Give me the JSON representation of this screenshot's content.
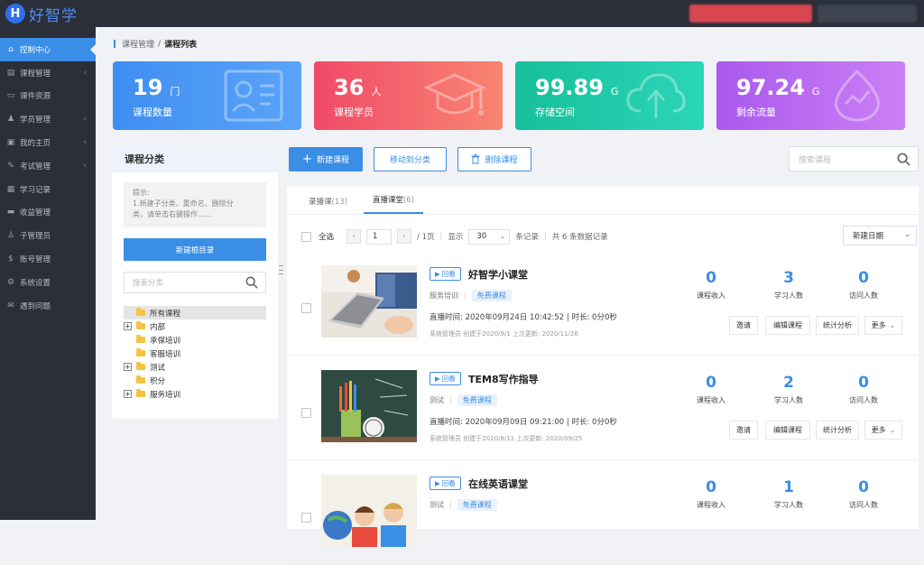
{
  "app": {
    "logo_letter": "H",
    "logo_text": "好智学"
  },
  "sidebar": {
    "items": [
      {
        "label": "控制中心",
        "icon": "home-icon",
        "glyph": "⌂",
        "arrow": false,
        "active": true
      },
      {
        "label": "课程管理",
        "icon": "book-icon",
        "glyph": "▤",
        "arrow": true,
        "active": false
      },
      {
        "label": "课件资源",
        "icon": "file-icon",
        "glyph": "▭",
        "arrow": false,
        "active": false
      },
      {
        "label": "学员管理",
        "icon": "user-icon",
        "glyph": "♟",
        "arrow": true,
        "active": false
      },
      {
        "label": "我的主页",
        "icon": "page-icon",
        "glyph": "▣",
        "arrow": true,
        "active": false
      },
      {
        "label": "考试管理",
        "icon": "exam-icon",
        "glyph": "✎",
        "arrow": true,
        "active": false
      },
      {
        "label": "学习记录",
        "icon": "record-icon",
        "glyph": "▦",
        "arrow": false,
        "active": false
      },
      {
        "label": "收益管理",
        "icon": "wallet-icon",
        "glyph": "▬",
        "arrow": false,
        "active": false
      },
      {
        "label": "子管理员",
        "icon": "admin-icon",
        "glyph": "♙",
        "arrow": false,
        "active": false
      },
      {
        "label": "账号管理",
        "icon": "dollar-icon",
        "glyph": "$",
        "arrow": false,
        "active": false
      },
      {
        "label": "系统设置",
        "icon": "gear-icon",
        "glyph": "⚙",
        "arrow": false,
        "active": false
      },
      {
        "label": "遇到问题",
        "icon": "help-icon",
        "glyph": "✉",
        "arrow": false,
        "active": false
      }
    ]
  },
  "breadcrumb": {
    "parent": "课程管理",
    "separator": "/",
    "current": "课程列表"
  },
  "stats_cards": [
    {
      "value": "19",
      "unit": "门",
      "label": "课程数量",
      "color": "#3d8cf0"
    },
    {
      "value": "36",
      "unit": "人",
      "label": "课程学员",
      "color": "#f0506e"
    },
    {
      "value": "99.89",
      "unit": "G",
      "label": "存储空间",
      "color": "#1fc3a3"
    },
    {
      "value": "97.24",
      "unit": "G",
      "label": "剩余流量",
      "color": "#b067f0"
    }
  ],
  "category_panel": {
    "title": "课程分类",
    "tip_lines": [
      "提示:",
      "1.新建子分类、重命名、删除分",
      "类，请单击右键操作......"
    ],
    "new_root_button": "新建根目录",
    "search_placeholder": "搜索分类",
    "tree": [
      {
        "label": "所有课程",
        "expandable": false,
        "selected": true
      },
      {
        "label": "内部",
        "expandable": true,
        "selected": false
      },
      {
        "label": "承保培训",
        "expandable": false,
        "selected": false
      },
      {
        "label": "客服培训",
        "expandable": false,
        "selected": false
      },
      {
        "label": "测试",
        "expandable": true,
        "selected": false
      },
      {
        "label": "积分",
        "expandable": false,
        "selected": false
      },
      {
        "label": "服务培训",
        "expandable": true,
        "selected": false
      }
    ]
  },
  "toolbar": {
    "new_course": "新建课程",
    "move_to_category": "移动到分类",
    "delete_course": "删除课程",
    "search_placeholder": "搜索课程"
  },
  "tabs": [
    {
      "label": "录播课",
      "count": "(13)",
      "active": false
    },
    {
      "label": "直播课堂",
      "count": "(6)",
      "active": true
    }
  ],
  "list_tools": {
    "select_all": "全选",
    "page_value": "1",
    "page_total": "/ 1页",
    "show_label": "显示",
    "page_size": "30",
    "records_label": "条记录",
    "total_text": "共 6 条数据记录",
    "sort_value": "新建日期"
  },
  "courses": [
    {
      "badge": "回看",
      "title": "好智学小课堂",
      "category": "服务培训",
      "price_tag": "免费课程",
      "time": "直播时间: 2020年09月24日 10:42:52 | 时长: 0分0秒",
      "meta": "系统管理员 创建于2020/9/1 上次更新: 2020/11/26",
      "revenue": "0",
      "learners": "3",
      "visitors": "0",
      "thumb": "laptop"
    },
    {
      "badge": "回看",
      "title": "TEM8写作指导",
      "category": "测试",
      "price_tag": "免费课程",
      "time": "直播时间: 2020年09月09日 09:21:00 | 时长: 0分0秒",
      "meta": "系统管理员 创建于2020/8/11 上次更新: 2020/09/25",
      "revenue": "0",
      "learners": "2",
      "visitors": "0",
      "thumb": "chalkboard"
    },
    {
      "badge": "回看",
      "title": "在线英语课堂",
      "category": "测试",
      "price_tag": "免费课程",
      "time": "",
      "meta": "",
      "revenue": "0",
      "learners": "1",
      "visitors": "0",
      "thumb": "kids"
    }
  ],
  "stat_labels": {
    "revenue": "课程收入",
    "learners": "学习人数",
    "visitors": "访问人数"
  },
  "actions": {
    "invite": "邀请",
    "edit": "编辑课程",
    "analytics": "统计分析",
    "more": "更多"
  }
}
